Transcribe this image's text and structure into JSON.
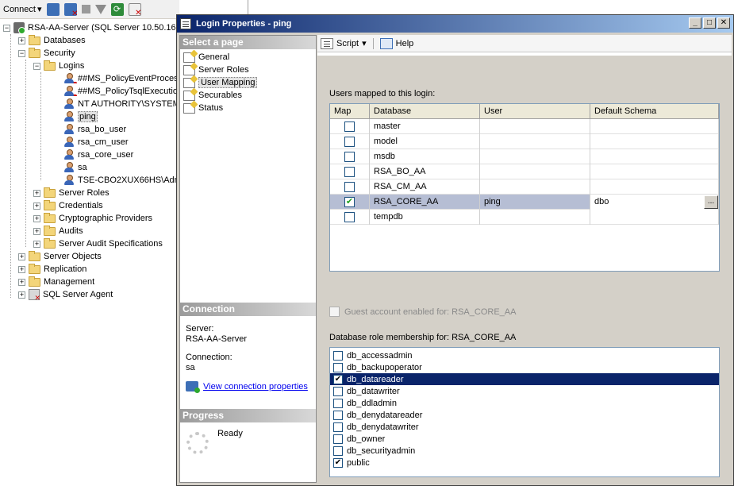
{
  "object_explorer": {
    "connect_label": "Connect",
    "connect_arrow": "▾",
    "server": "RSA-AA-Server (SQL Server 10.50.16",
    "databases": "Databases",
    "security": "Security",
    "logins": "Logins",
    "login_items": [
      "##MS_PolicyEventProces",
      "##MS_PolicyTsqlExecutio",
      "NT AUTHORITY\\SYSTEM",
      "ping",
      "rsa_bo_user",
      "rsa_cm_user",
      "rsa_core_user",
      "sa",
      "TSE-CBO2XUX66HS\\Admir"
    ],
    "security_children": [
      "Server Roles",
      "Credentials",
      "Cryptographic Providers",
      "Audits",
      "Server Audit Specifications"
    ],
    "top_items": [
      "Server Objects",
      "Replication",
      "Management",
      "SQL Server Agent"
    ]
  },
  "dialog": {
    "title": "Login Properties - ping",
    "window_buttons": {
      "minimize": "_",
      "maximize": "□",
      "close": "✕"
    },
    "select_page_header": "Select a page",
    "pages": [
      "General",
      "Server Roles",
      "User Mapping",
      "Securables",
      "Status"
    ],
    "selected_page": "User Mapping",
    "connection_header": "Connection",
    "server_label": "Server:",
    "server_value": "RSA-AA-Server",
    "connection_label": "Connection:",
    "connection_value": "sa",
    "view_conn_link": "View connection properties",
    "progress_header": "Progress",
    "progress_status": "Ready",
    "toolbar": {
      "script": "Script",
      "script_arrow": "▾",
      "help": "Help"
    },
    "users_mapped_label": "Users mapped to this login:",
    "grid_headers": {
      "map": "Map",
      "database": "Database",
      "user": "User",
      "schema": "Default Schema"
    },
    "grid_rows": [
      {
        "map": "",
        "database": "master",
        "user": "",
        "schema": ""
      },
      {
        "map": "",
        "database": "model",
        "user": "",
        "schema": ""
      },
      {
        "map": "",
        "database": "msdb",
        "user": "",
        "schema": ""
      },
      {
        "map": "",
        "database": "RSA_BO_AA",
        "user": "",
        "schema": ""
      },
      {
        "map": "",
        "database": "RSA_CM_AA",
        "user": "",
        "schema": ""
      },
      {
        "map": "✔",
        "database": "RSA_CORE_AA",
        "user": "ping",
        "schema": "dbo"
      },
      {
        "map": "",
        "database": "tempdb",
        "user": "",
        "schema": ""
      }
    ],
    "ellipsis": "...",
    "guest_label": "Guest account enabled for: RSA_CORE_AA",
    "role_membership_label": "Database role membership for: RSA_CORE_AA",
    "roles": [
      {
        "name": "db_accessadmin",
        "check": ""
      },
      {
        "name": "db_backupoperator",
        "check": ""
      },
      {
        "name": "db_datareader",
        "check": "✔"
      },
      {
        "name": "db_datawriter",
        "check": ""
      },
      {
        "name": "db_ddladmin",
        "check": ""
      },
      {
        "name": "db_denydatareader",
        "check": ""
      },
      {
        "name": "db_denydatawriter",
        "check": ""
      },
      {
        "name": "db_owner",
        "check": ""
      },
      {
        "name": "db_securityadmin",
        "check": ""
      },
      {
        "name": "public",
        "check": "✔"
      }
    ]
  },
  "colors": {
    "title_gradient_start": "#0a246a",
    "selected_row": "#b6bed4",
    "selected_role": "#0a246a",
    "dialog_face": "#d4d0c8"
  }
}
